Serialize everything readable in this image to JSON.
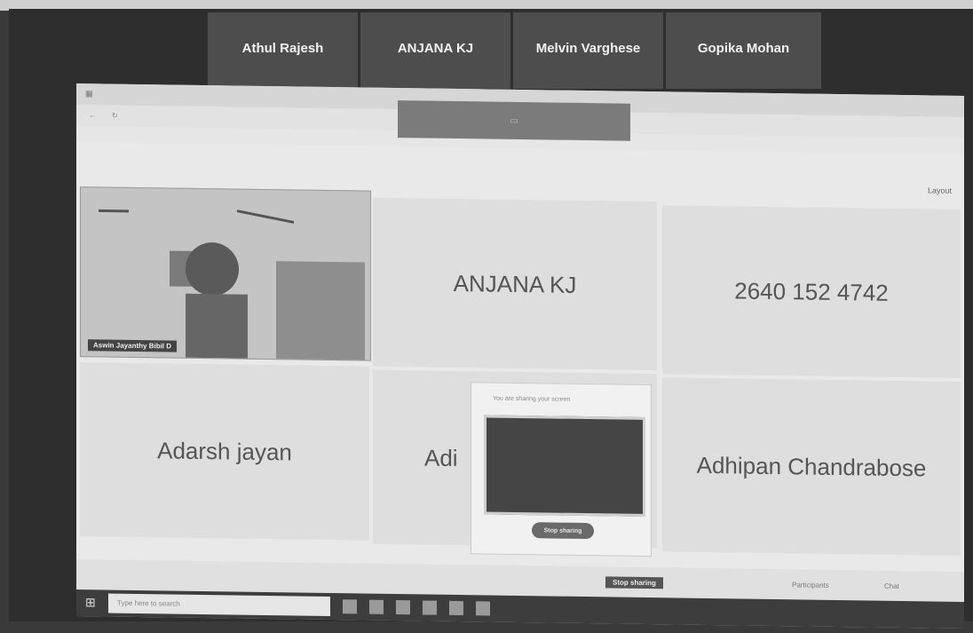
{
  "participants_top": [
    "Athul Rajesh",
    "ANJANA KJ",
    "Melvin Varghese",
    "Gopika Mohan"
  ],
  "grid": {
    "video_name": "Aswin Jayanthy Bibil D",
    "anjana": "ANJANA KJ",
    "phone": "2640 152 4742",
    "adarsh": "Adarsh jayan",
    "adi": "Adi",
    "adhipan": "Adhipan Chandrabose"
  },
  "dialog": {
    "title": "You are sharing your screen",
    "stop_label": "Stop sharing"
  },
  "bottom": {
    "share_text": "Stop sharing",
    "participants": "Participants",
    "chat": "Chat",
    "layout": "Layout"
  },
  "taskbar": {
    "search_placeholder": "Type here to search"
  },
  "colors": {
    "tile_bg": "#4d4d4d",
    "frame_bg": "#2e2e2e",
    "screen_bg": "#e9e9e9"
  }
}
